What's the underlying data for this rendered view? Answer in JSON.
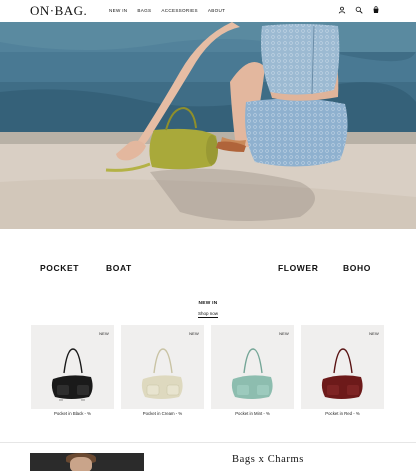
{
  "header": {
    "logo": "ON·BAG.",
    "nav": [
      "NEW IN",
      "BAGS",
      "ACCESSORIES",
      "ABOUT"
    ],
    "icons": [
      "user-icon",
      "search-icon",
      "cart-icon"
    ]
  },
  "hero": {
    "alt_colors": {
      "pool": "#3f6d86",
      "deck": "#d9cfc4",
      "bag": "#a9a93a",
      "outfit": "#8fb1cf"
    }
  },
  "categories": [
    "POCKET",
    "BOAT",
    "FLOWER",
    "BOHO"
  ],
  "new_in": {
    "title": "NEW IN",
    "link": "Shop now",
    "products": [
      {
        "name": "Pocket in Black - %",
        "badge": "NEW",
        "color": "#1a1a1a"
      },
      {
        "name": "Pocket in Cream - %",
        "badge": "NEW",
        "color": "#ded9bf"
      },
      {
        "name": "Pocket in Mint - %",
        "badge": "NEW",
        "color": "#8dbdaf"
      },
      {
        "name": "Pocket in Red - %",
        "badge": "NEW",
        "color": "#6d1a1a"
      }
    ]
  },
  "feature": {
    "title": "Bags x Charms"
  }
}
